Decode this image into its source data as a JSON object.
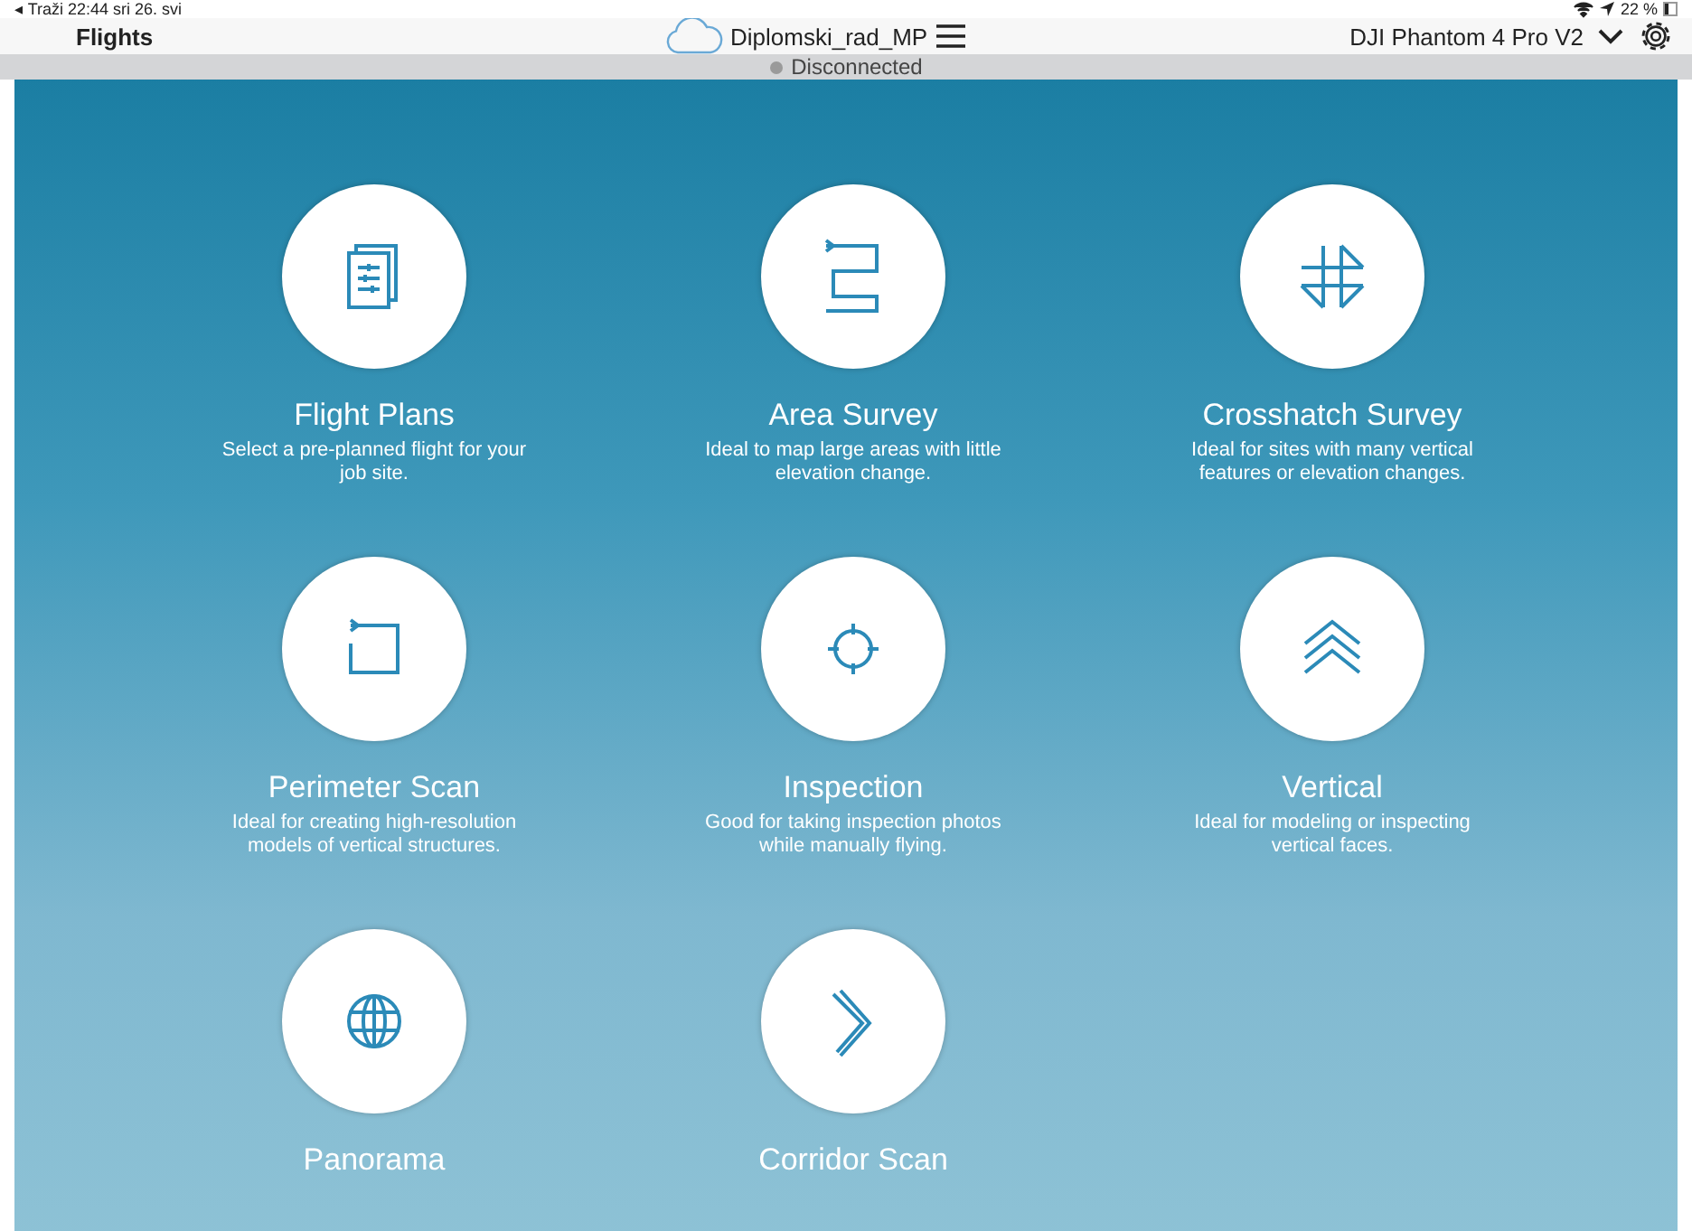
{
  "status_bar": {
    "left": "◂ Traži  22:44  sri 26. svi",
    "battery": "22 %"
  },
  "nav_bar": {
    "title": "Flights",
    "project": "Diplomski_rad_MP",
    "drone": "DJI Phantom 4 Pro V2"
  },
  "connection": {
    "label": "Disconnected",
    "connected": false
  },
  "missions": [
    {
      "title": "Flight Plans",
      "description": "Select a pre-planned flight for your job site."
    },
    {
      "title": "Area Survey",
      "description": "Ideal to map large areas with little elevation change."
    },
    {
      "title": "Crosshatch Survey",
      "description": "Ideal for sites with many vertical features or elevation changes."
    },
    {
      "title": "Perimeter Scan",
      "description": "Ideal for creating high-resolution models of vertical structures."
    },
    {
      "title": "Inspection",
      "description": "Good for taking inspection photos while manually flying."
    },
    {
      "title": "Vertical",
      "description": "Ideal for modeling or inspecting vertical faces."
    },
    {
      "title": "Panorama"
    },
    {
      "title": "Corridor Scan"
    }
  ]
}
